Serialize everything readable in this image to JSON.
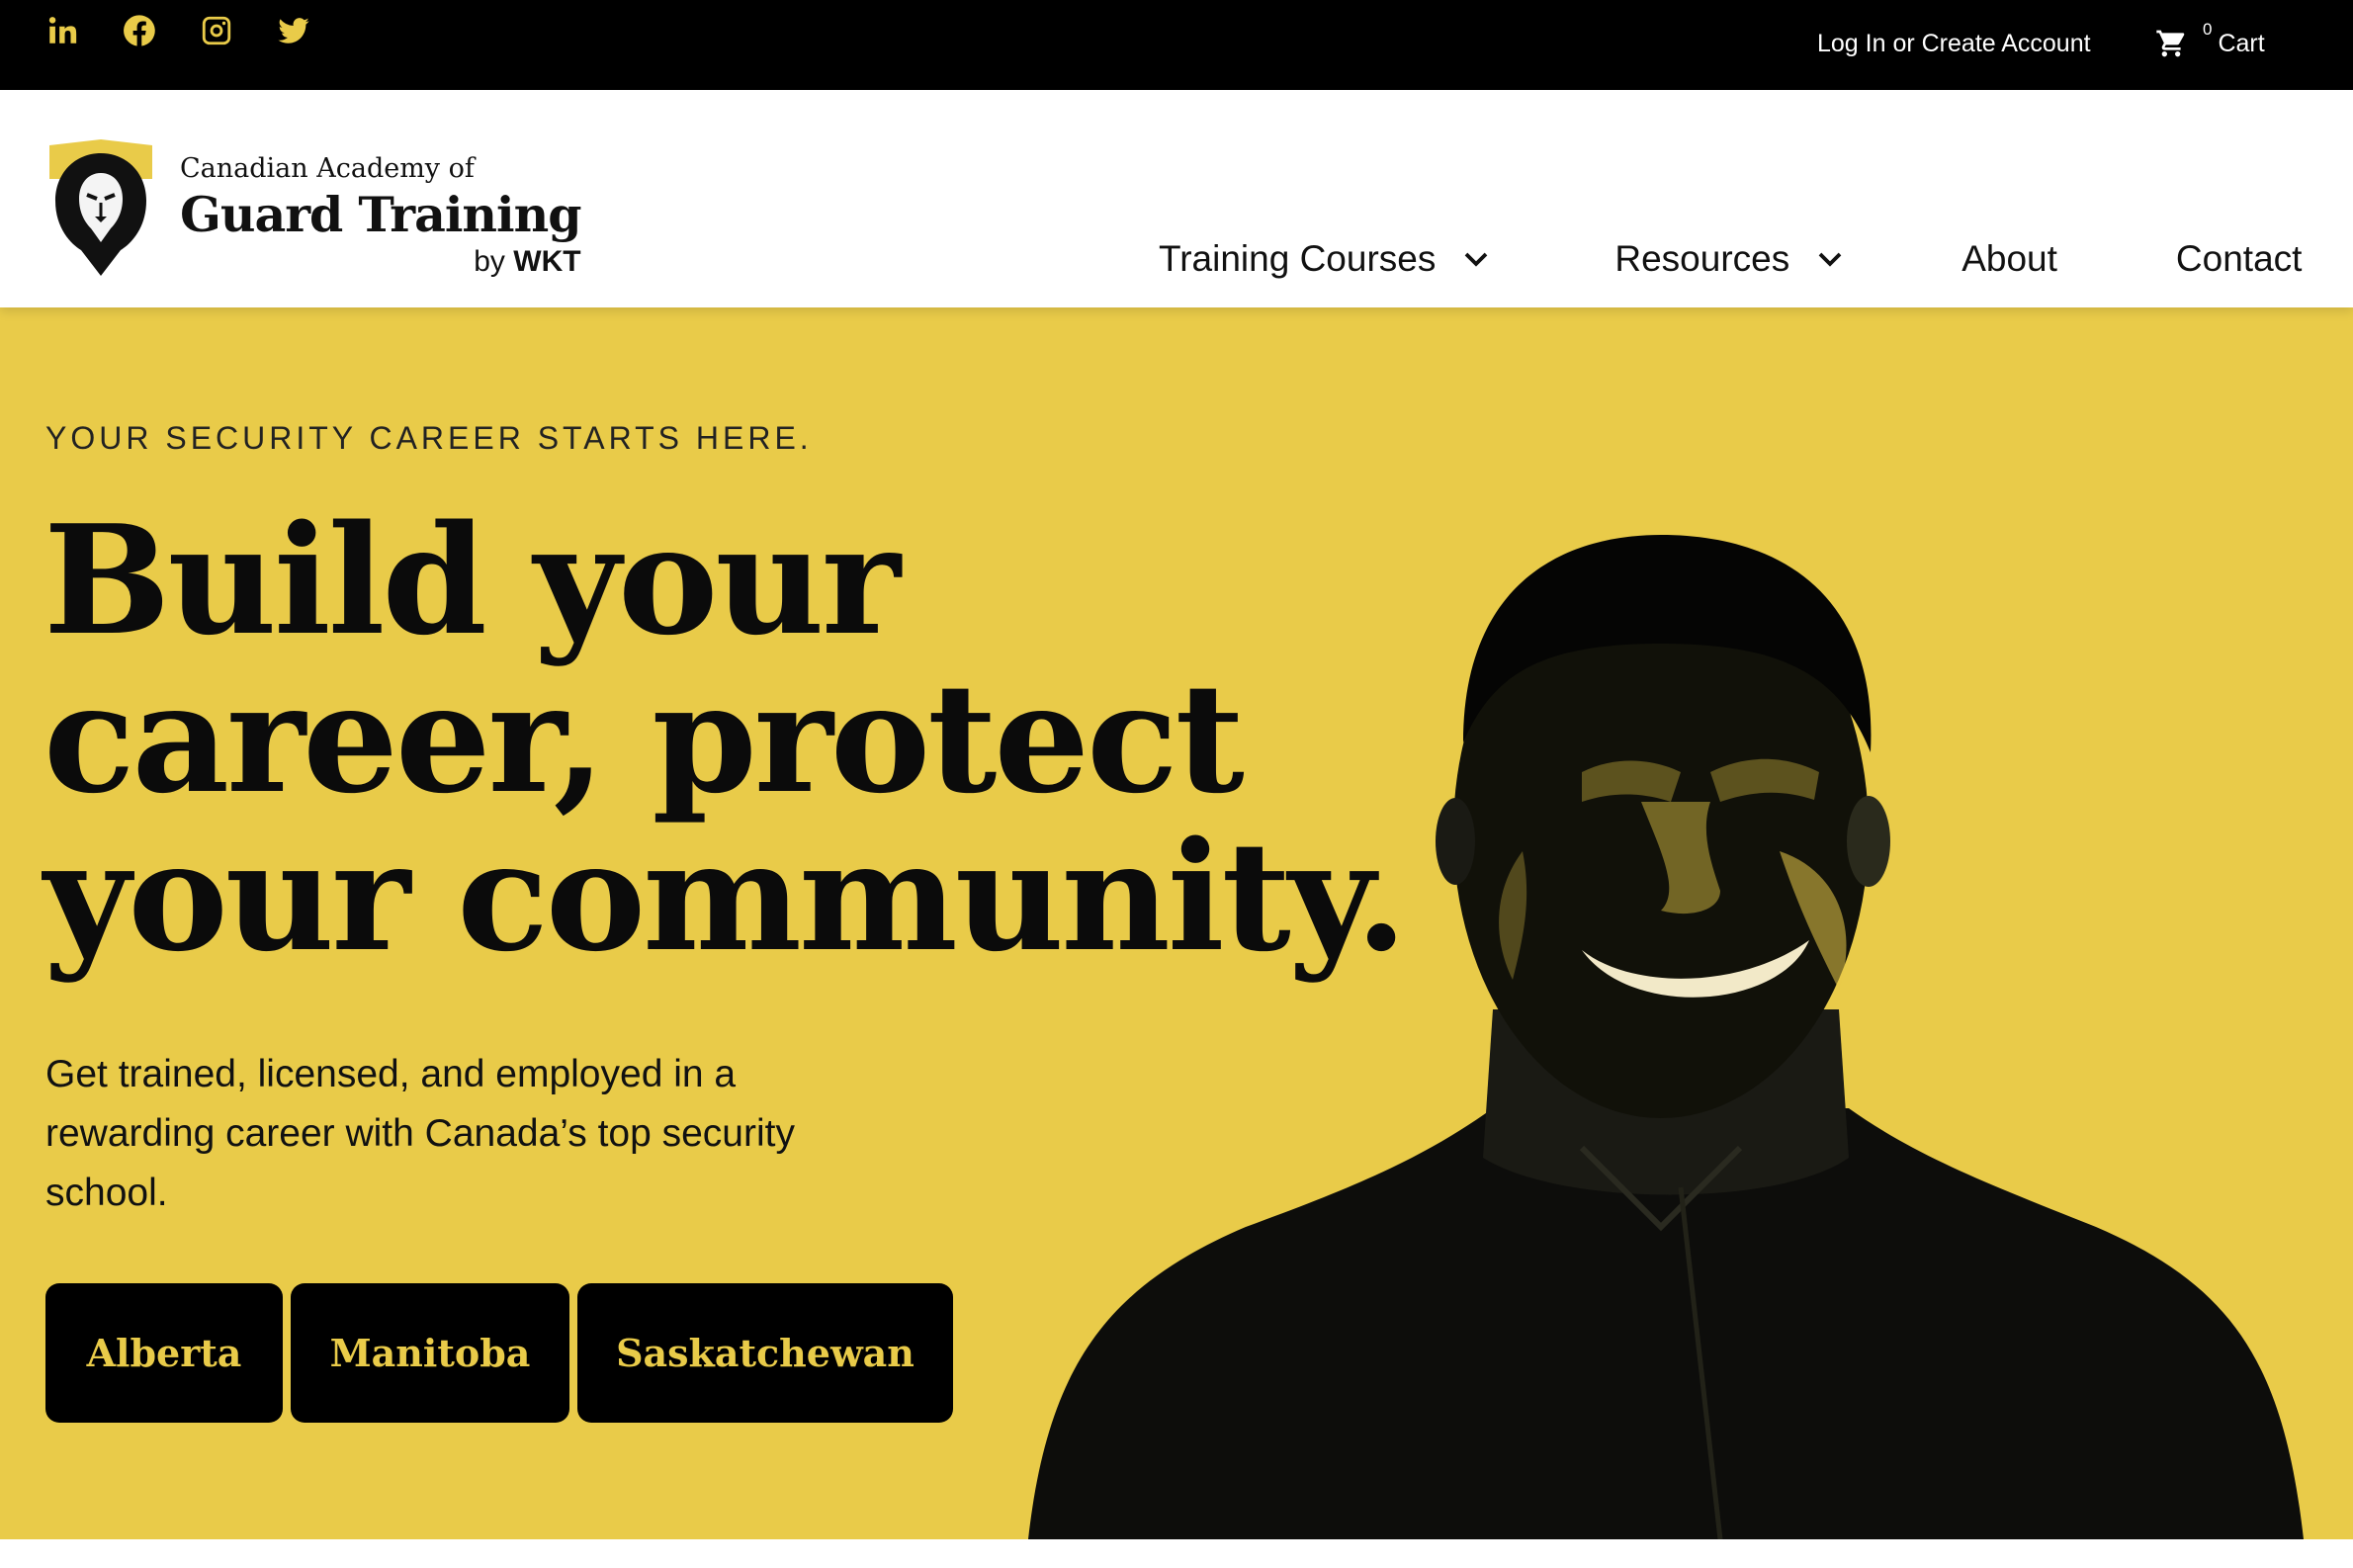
{
  "topbar": {
    "social": [
      "linkedin-icon",
      "facebook-icon",
      "instagram-icon",
      "twitter-icon"
    ],
    "account_link": "Log In or Create Account",
    "cart_count": "0",
    "cart_label": "Cart"
  },
  "header": {
    "logo": {
      "sub": "Canadian Academy of",
      "main": "Guard Training",
      "by_prefix": "by",
      "by_brand": "WKT"
    },
    "nav": {
      "training": "Training Courses",
      "resources": "Resources",
      "about": "About",
      "contact": "Contact"
    }
  },
  "hero": {
    "eyebrow": "YOUR SECURITY CAREER STARTS HERE.",
    "headline": [
      "Build your",
      "career, protect",
      "your community."
    ],
    "lede": "Get trained, licensed, and employed in a rewarding career with Canada’s top security school.",
    "buttons": {
      "alberta": "Alberta",
      "manitoba": "Manitoba",
      "saskatchewan": "Saskatchewan"
    }
  },
  "colors": {
    "accent": "#e9cb49",
    "dark": "#000000"
  }
}
